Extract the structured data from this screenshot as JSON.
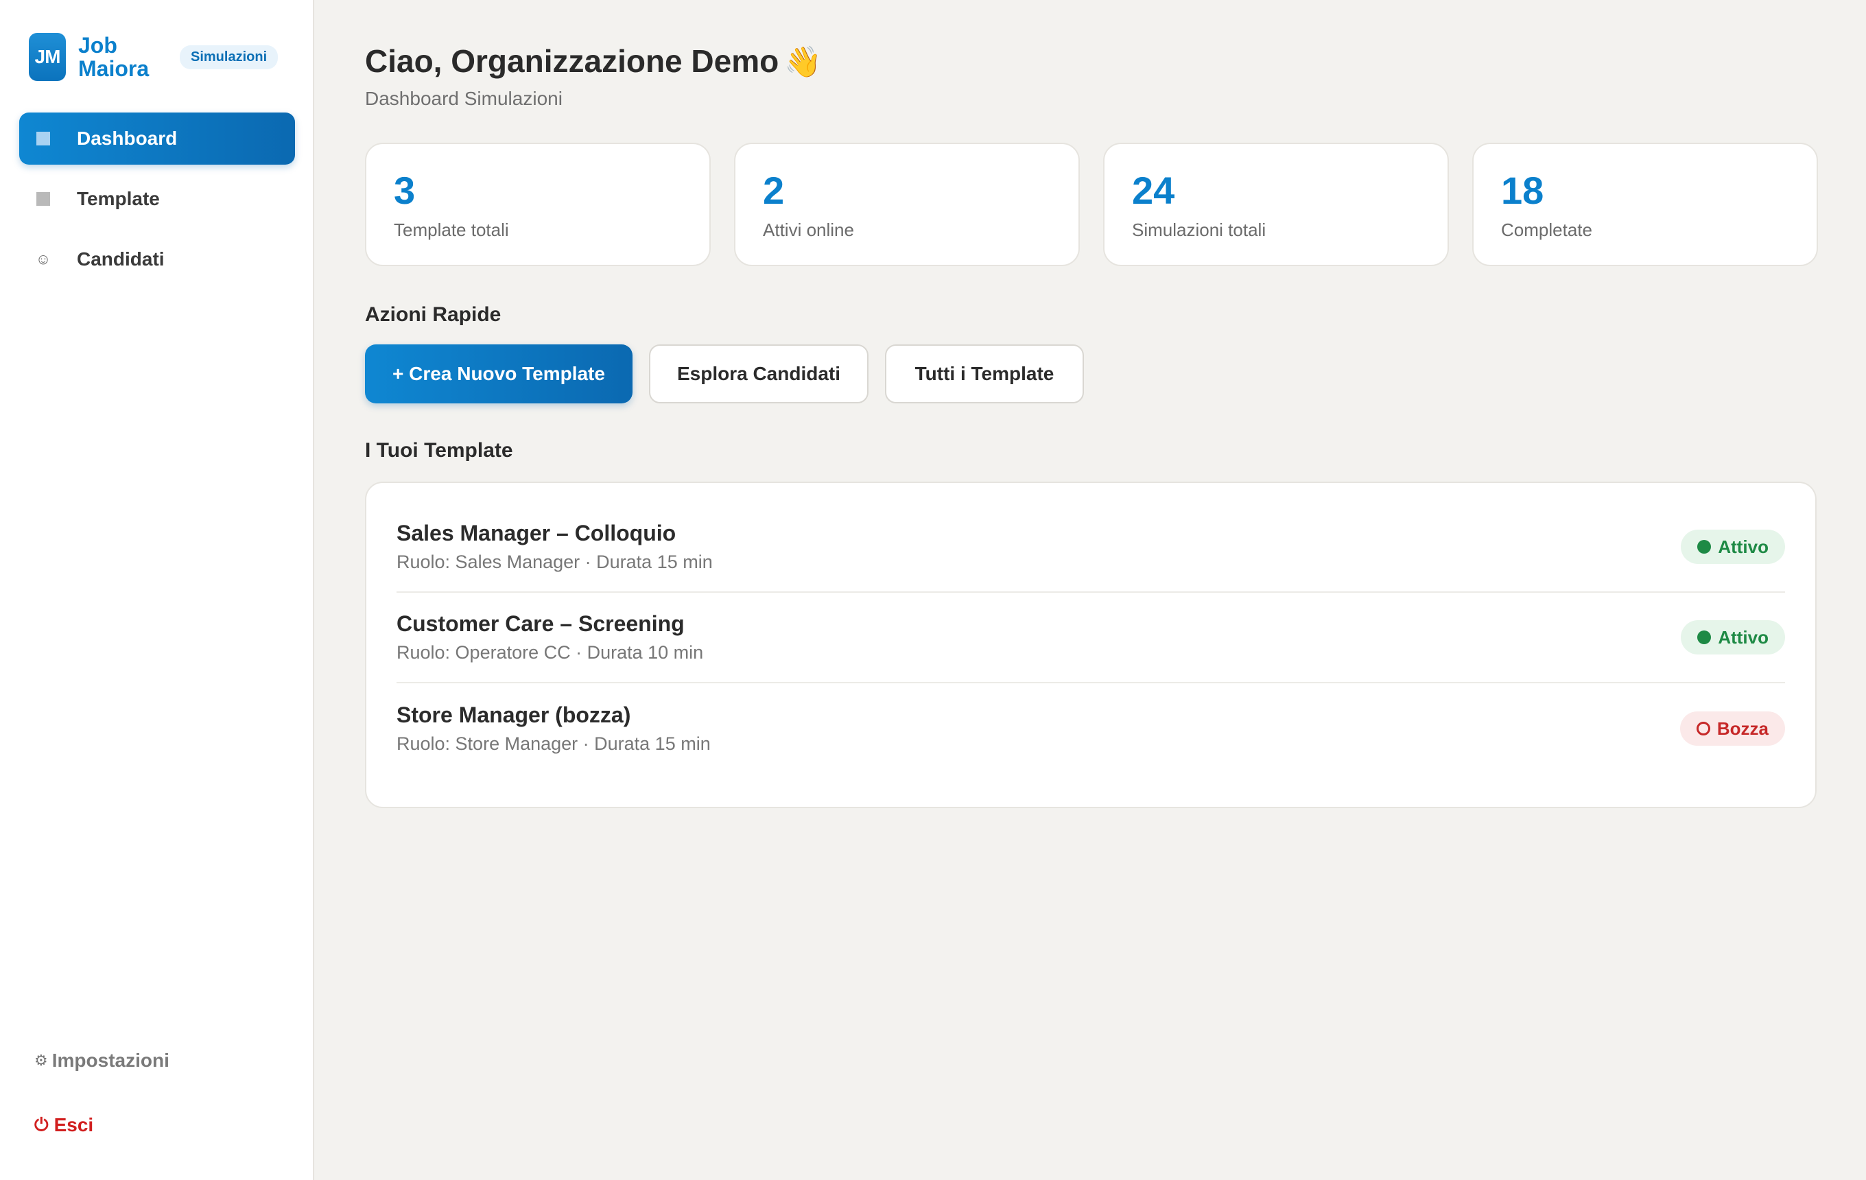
{
  "brand": {
    "logo_text": "JM",
    "name_line1": "Job",
    "name_line2": "Maiora",
    "badge": "Simulazioni"
  },
  "sidebar": {
    "items": [
      {
        "label": "Dashboard",
        "icon": "square-icon",
        "active": true
      },
      {
        "label": "Template",
        "icon": "square-icon",
        "active": false
      },
      {
        "label": "Candidati",
        "icon": "smiley-icon",
        "active": false
      }
    ],
    "settings_label": "Impostazioni",
    "settings_icon": "gear-icon",
    "logout_label": "Esci",
    "logout_icon": "power-icon"
  },
  "header": {
    "greeting": "Ciao, Organizzazione Demo",
    "greeting_icon": "waving-hand-icon",
    "subtitle": "Dashboard Simulazioni"
  },
  "stats": [
    {
      "value": "3",
      "label": "Template totali"
    },
    {
      "value": "2",
      "label": "Attivi online"
    },
    {
      "value": "24",
      "label": "Simulazioni totali"
    },
    {
      "value": "18",
      "label": "Completate"
    }
  ],
  "quick_actions": {
    "title": "Azioni Rapide",
    "create": "+ Crea Nuovo Template",
    "explore": "Esplora Candidati",
    "all": "Tutti i Template"
  },
  "templates": {
    "title": "I Tuoi Template",
    "items": [
      {
        "title": "Sales Manager – Colloquio",
        "meta": "Ruolo: Sales Manager · Durata 15 min",
        "status": "Attivo"
      },
      {
        "title": "Customer Care – Screening",
        "meta": "Ruolo: Operatore CC · Durata 10 min",
        "status": "Attivo"
      },
      {
        "title": "Store Manager (bozza)",
        "meta": "Ruolo: Store Manager · Durata 15 min",
        "status": "Bozza"
      }
    ]
  },
  "colors": {
    "accent": "#0b80cc",
    "active_status": "#1e8a45",
    "draft_status": "#c62828",
    "logout": "#d11f1f"
  }
}
